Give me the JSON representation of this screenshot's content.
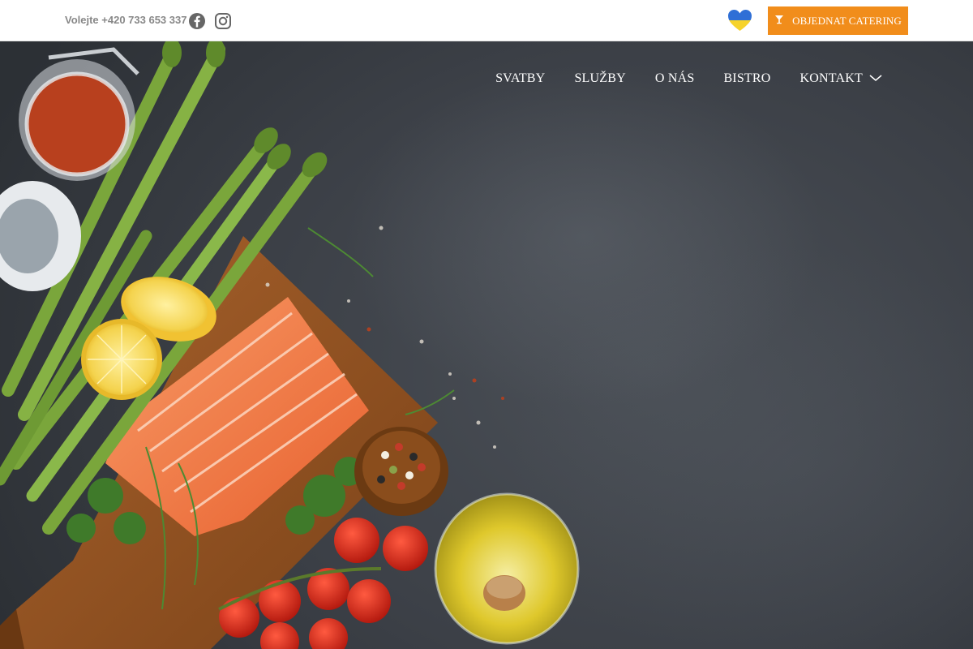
{
  "topbar": {
    "phone": "Volejte +420 733 653 337",
    "facebook_icon": "facebook-icon",
    "instagram_icon": "instagram-icon",
    "ukraine_heart_icon": "ukraine-heart-icon",
    "cta_icon": "cocktail-icon",
    "cta_label": "OBJEDNAT CATERING"
  },
  "nav": {
    "items": [
      {
        "label": "SVATBY"
      },
      {
        "label": "SLUŽBY"
      },
      {
        "label": "O NÁS"
      },
      {
        "label": "BISTRO"
      },
      {
        "label": "KONTAKT"
      }
    ],
    "dropdown_icon": "chevron-down-icon"
  },
  "colors": {
    "accent": "#f18d1b",
    "topbar_bg": "#ffffff",
    "hero_bg": "#3c4047",
    "nav_text": "#ffffff",
    "phone_text": "#888888"
  }
}
